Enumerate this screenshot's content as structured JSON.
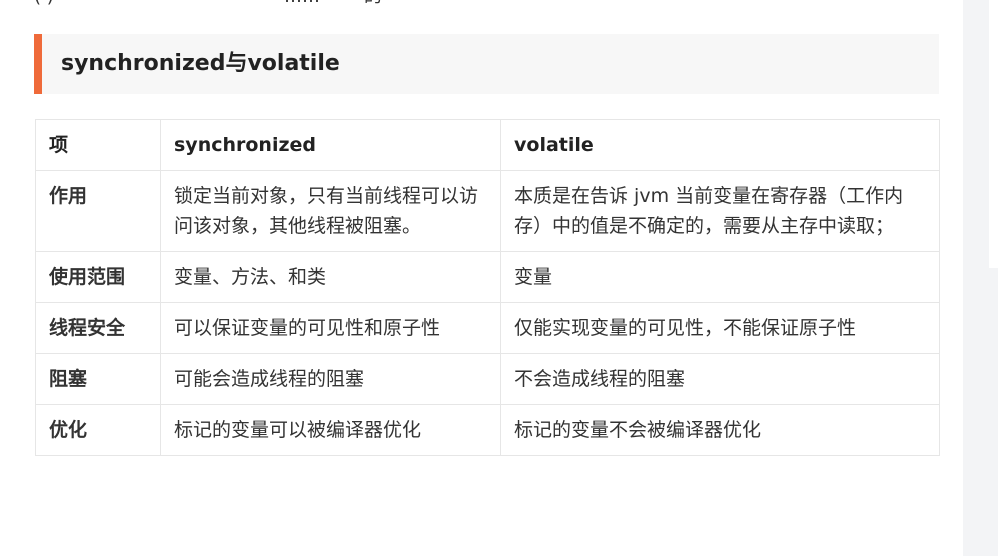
{
  "top_line_fragments": [
    "( )",
    "……",
    "的一"
  ],
  "heading": "synchronized与volatile",
  "table": {
    "headers": [
      "项",
      "synchronized",
      "volatile"
    ],
    "rows": [
      [
        "作用",
        "锁定当前对象，只有当前线程可以访问该对象，其他线程被阻塞。",
        "本质是在告诉 jvm 当前变量在寄存器（工作内存）中的值是不确定的，需要从主存中读取；"
      ],
      [
        "使用范围",
        "变量、方法、和类",
        "变量"
      ],
      [
        "线程安全",
        "可以保证变量的可见性和原子性",
        "仅能实现变量的可见性，不能保证原子性"
      ],
      [
        "阻塞",
        "可能会造成线程的阻塞",
        "不会造成线程的阻塞"
      ],
      [
        "优化",
        "标记的变量可以被编译器优化",
        "标记的变量不会被编译器优化"
      ]
    ]
  },
  "colors": {
    "accent": "#ef6a3a",
    "heading_bg": "#f7f7f7",
    "border": "#e6e6e6",
    "gutter": "#f3f4f6"
  }
}
